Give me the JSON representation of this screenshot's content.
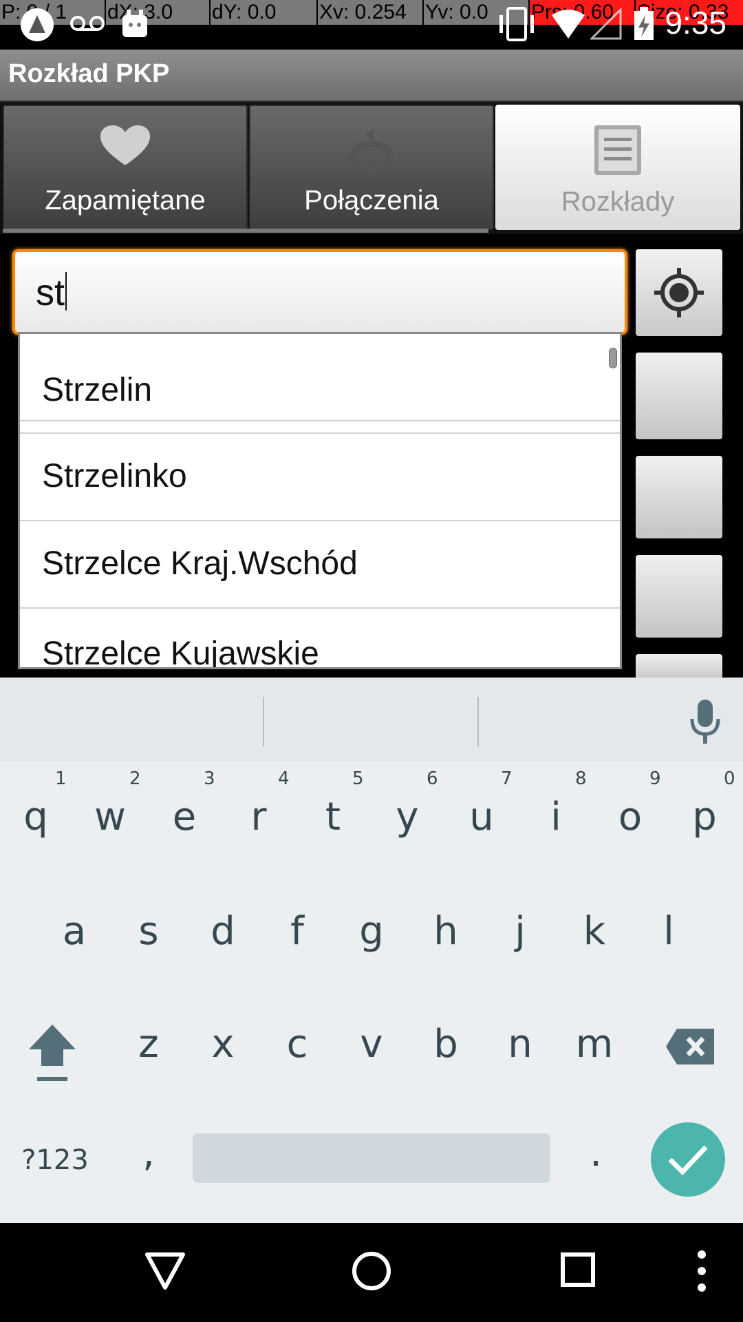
{
  "debug_bar": {
    "pointer": "P: 0 / 1",
    "dx": "dX: 3.0",
    "dy": "dY: 0.0",
    "xv": "Xv: 0.254",
    "yv": "Yv: 0.0",
    "prs": "Prs: 0.60",
    "size": "Size: 0.33"
  },
  "status_bar": {
    "time": "9:35",
    "icons": [
      "android-icon",
      "voicemail-icon",
      "notification-icon",
      "vibrate-icon",
      "wifi-icon",
      "signal-icon",
      "battery-icon"
    ]
  },
  "app": {
    "title": "Rozkład PKP"
  },
  "tabs": [
    {
      "label": "Zapamiętane",
      "icon": "heart-icon",
      "active": false
    },
    {
      "label": "Połączenia",
      "icon": "connections-icon",
      "active": false
    },
    {
      "label": "Rozkłady",
      "icon": "list-icon",
      "active": true
    }
  ],
  "search": {
    "value": "st"
  },
  "suggestions": [
    "Strzelin",
    "Strzelinko",
    "Strzelce Kraj.Wschód",
    "Strzelce Kujawskie"
  ],
  "keyboard": {
    "row1": [
      "q",
      "w",
      "e",
      "r",
      "t",
      "y",
      "u",
      "i",
      "o",
      "p"
    ],
    "row1_hints": [
      "1",
      "2",
      "3",
      "4",
      "5",
      "6",
      "7",
      "8",
      "9",
      "0"
    ],
    "row2": [
      "a",
      "s",
      "d",
      "f",
      "g",
      "h",
      "j",
      "k",
      "l"
    ],
    "row3": [
      "z",
      "x",
      "c",
      "v",
      "b",
      "n",
      "m"
    ],
    "symbols_label": "?123",
    "comma": ",",
    "period": ".",
    "accent_color": "#4db6ac"
  },
  "nav_bar": {
    "icons": [
      "back-icon",
      "home-icon",
      "recents-icon",
      "menu-icon"
    ]
  }
}
